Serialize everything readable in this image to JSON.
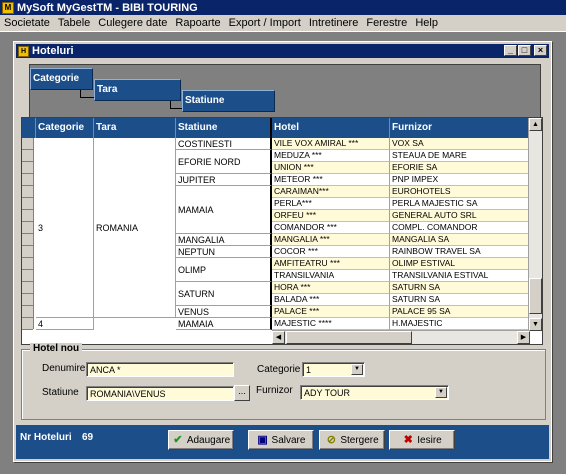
{
  "app": {
    "title": "MySoft MyGestTM  - BIBI TOURING"
  },
  "menu": [
    "Societate",
    "Tabele",
    "Culegere date",
    "Rapoarte",
    "Export / Import",
    "Intretinere",
    "Ferestre",
    "Help"
  ],
  "window": {
    "title": "Hoteluri",
    "minimize": "_",
    "maximize": "□",
    "close": "×"
  },
  "group_by": [
    "Categorie",
    "Tara",
    "Statiune"
  ],
  "grid": {
    "columns": [
      "Categorie",
      "Tara",
      "Statiune",
      "Hotel",
      "Furnizor"
    ],
    "categorie_groups": [
      {
        "value": "3",
        "rows": 15
      },
      {
        "value": "4",
        "rows": 1
      }
    ],
    "tara_groups": [
      {
        "value": "ROMANIA",
        "rows": 15
      }
    ],
    "statiune_groups": [
      {
        "value": "COSTINESTI",
        "rows": 1
      },
      {
        "value": "EFORIE NORD",
        "rows": 2
      },
      {
        "value": "JUPITER",
        "rows": 1
      },
      {
        "value": "MAMAIA",
        "rows": 4
      },
      {
        "value": "MANGALIA",
        "rows": 1
      },
      {
        "value": "NEPTUN",
        "rows": 1
      },
      {
        "value": "OLIMP",
        "rows": 2
      },
      {
        "value": "SATURN",
        "rows": 2
      },
      {
        "value": "VENUS",
        "rows": 1
      },
      {
        "value": "MAMAIA",
        "rows": 1
      }
    ],
    "rows": [
      {
        "hotel": "VILE VOX AMIRAL ***",
        "furnizor": "VOX SA"
      },
      {
        "hotel": "MEDUZA ***",
        "furnizor": "STEAUA DE MARE"
      },
      {
        "hotel": "UNION ***",
        "furnizor": "EFORIE SA"
      },
      {
        "hotel": "METEOR ***",
        "furnizor": "PNP IMPEX"
      },
      {
        "hotel": "CARAIMAN***",
        "furnizor": "EUROHOTELS"
      },
      {
        "hotel": "PERLA***",
        "furnizor": "PERLA MAJESTIC SA"
      },
      {
        "hotel": "ORFEU ***",
        "furnizor": "GENERAL AUTO SRL"
      },
      {
        "hotel": "COMANDOR ***",
        "furnizor": "COMPL. COMANDOR"
      },
      {
        "hotel": "MANGALIA ***",
        "furnizor": "MANGALIA SA"
      },
      {
        "hotel": "COCOR ***",
        "furnizor": "RAINBOW TRAVEL SA"
      },
      {
        "hotel": "AMFITEATRU ***",
        "furnizor": "OLIMP ESTIVAL"
      },
      {
        "hotel": "TRANSILVANIA",
        "furnizor": "TRANSILVANIA ESTIVAL"
      },
      {
        "hotel": "HORA ***",
        "furnizor": "SATURN SA"
      },
      {
        "hotel": "BALADA ***",
        "furnizor": "SATURN SA"
      },
      {
        "hotel": "PALACE ***",
        "furnizor": "PALACE 95 SA"
      },
      {
        "hotel": "MAJESTIC ****",
        "furnizor": "H.MAJESTIC"
      }
    ]
  },
  "form": {
    "legend": "Hotel  nou",
    "denumire_label": "Denumire",
    "denumire_value": "ANCA *",
    "statiune_label": "Statiune",
    "statiune_value": "ROMANIA\\VENUS",
    "categorie_label": "Categorie",
    "categorie_value": "1",
    "furnizor_label": "Furnizor",
    "furnizor_value": "ADY TOUR",
    "dots": "..."
  },
  "status": {
    "label": "Nr Hoteluri",
    "value": "69"
  },
  "buttons": {
    "adaugare": "Adaugare",
    "salvare": "Salvare",
    "stergere": "Stergere",
    "iesire": "Iesire"
  },
  "colors": {
    "header_blue": "#1c4e8a",
    "title_blue": "#0a246a",
    "row_yellow": "#fffbd8"
  }
}
